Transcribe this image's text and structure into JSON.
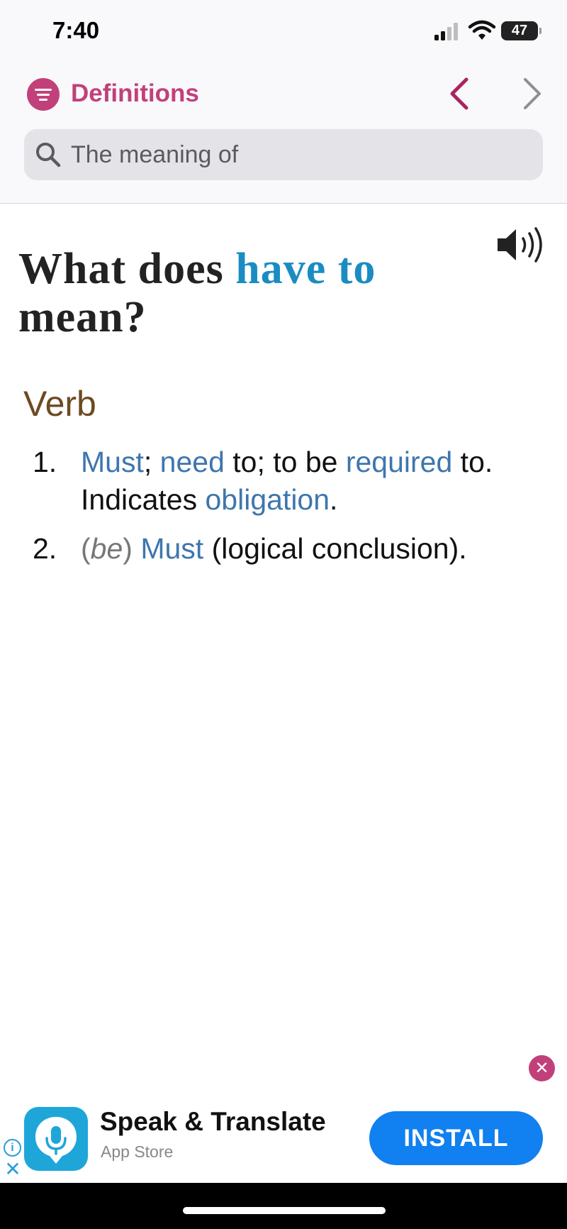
{
  "status_bar": {
    "time": "7:40",
    "battery": "47"
  },
  "header": {
    "title": "Definitions",
    "accent_color": "#c2407a"
  },
  "search": {
    "placeholder": "The meaning of"
  },
  "entry": {
    "heading_prefix": "What does",
    "term": "have to",
    "heading_suffix": "mean?",
    "part_of_speech": "Verb",
    "definitions": [
      {
        "number": "1.",
        "parts": [
          "Must",
          ";",
          "need",
          " to; to be ",
          "required",
          " to. Indicates ",
          "obligation",
          "."
        ]
      },
      {
        "number": "2.",
        "parts": [
          "(",
          "be",
          ")",
          " ",
          "Must",
          " (logical conclusion)."
        ]
      }
    ]
  },
  "ad": {
    "app_name": "Speak & Translate",
    "source": "App Store",
    "install_label": "INSTALL",
    "close_glyph": "✕",
    "info_glyph": "i",
    "x_glyph": "✕"
  }
}
